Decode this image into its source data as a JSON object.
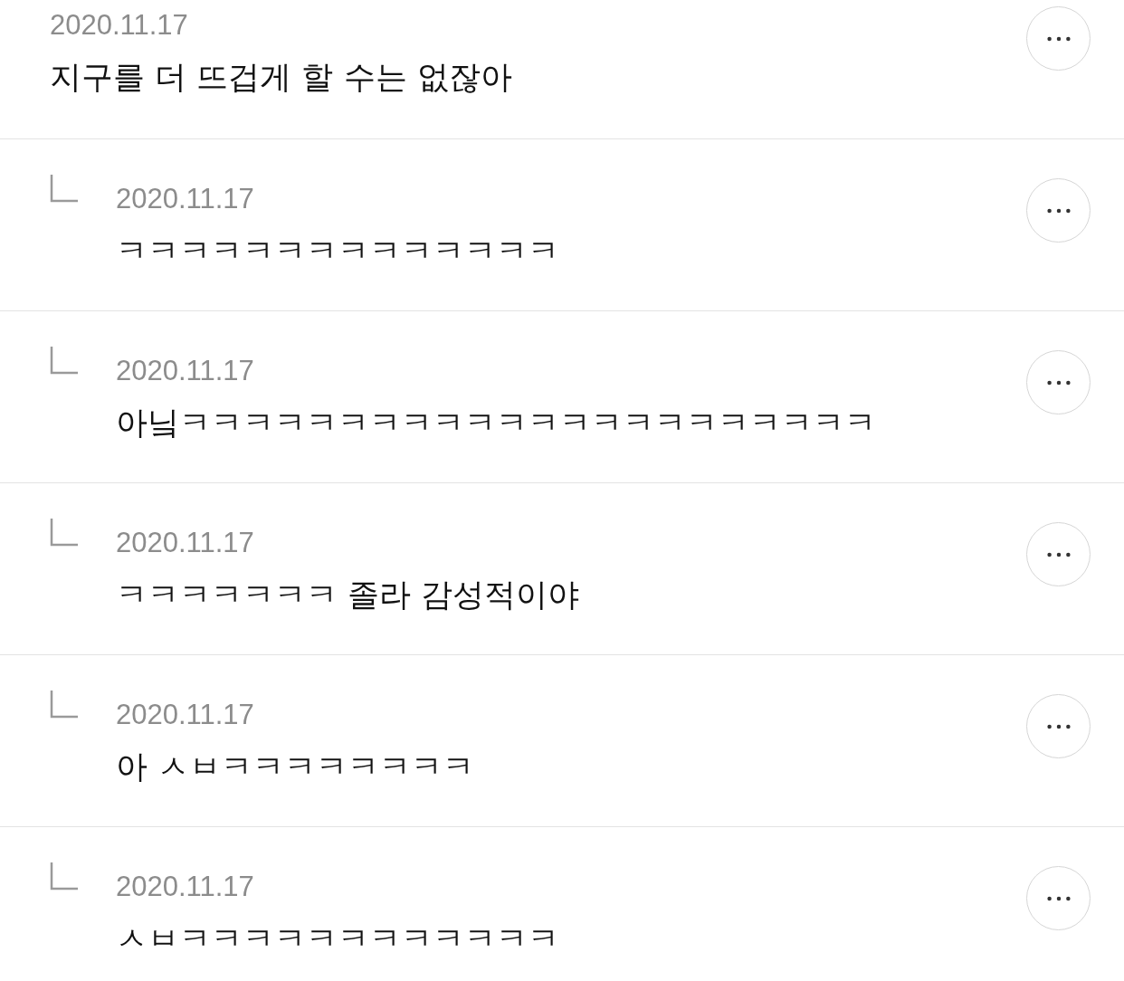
{
  "comments": [
    {
      "kind": "comment",
      "date": "2020.11.17",
      "text": "지구를 더 뜨겁게 할 수는 없잖아"
    },
    {
      "kind": "reply",
      "date": "2020.11.17",
      "text": "ㅋㅋㅋㅋㅋㅋㅋㅋㅋㅋㅋㅋㅋㅋ"
    },
    {
      "kind": "reply",
      "date": "2020.11.17",
      "text": "아닠ㅋㅋㅋㅋㅋㅋㅋㅋㅋㅋㅋㅋㅋㅋㅋㅋㅋㅋㅋㅋㅋㅋ"
    },
    {
      "kind": "reply",
      "date": "2020.11.17",
      "text": "ㅋㅋㅋㅋㅋㅋㅋ 졸라 감성적이야"
    },
    {
      "kind": "reply",
      "date": "2020.11.17",
      "text": "아 ㅅㅂㅋㅋㅋㅋㅋㅋㅋㅋ"
    },
    {
      "kind": "reply",
      "date": "2020.11.17",
      "text": "ㅅㅂㅋㅋㅋㅋㅋㅋㅋㅋㅋㅋㅋㅋ"
    }
  ]
}
